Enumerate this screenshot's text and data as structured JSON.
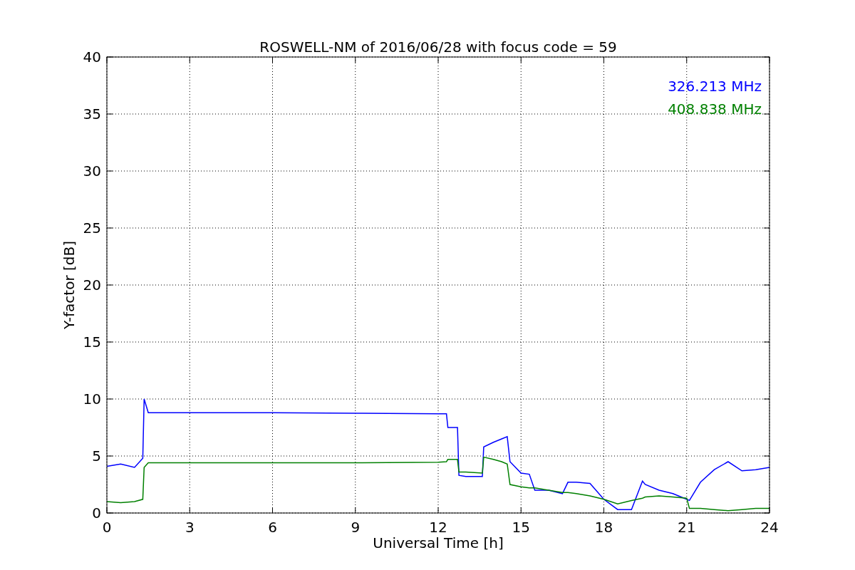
{
  "chart_data": {
    "type": "line",
    "title": "ROSWELL-NM of 2016/06/28 with focus code = 59",
    "xlabel": "Universal Time [h]",
    "ylabel": "Y-factor [dB]",
    "x": [
      0,
      0.5,
      1,
      1.3,
      1.35,
      1.5,
      3,
      6,
      9,
      12,
      12.3,
      12.35,
      12.7,
      12.75,
      13,
      13.6,
      13.65,
      14,
      14.3,
      14.5,
      14.6,
      15,
      15.3,
      15.5,
      16,
      16.5,
      16.7,
      17,
      17.5,
      18,
      18.5,
      19,
      19.4,
      19.5,
      20,
      20.5,
      21,
      21.1,
      21.5,
      22,
      22.5,
      23,
      23.5,
      24
    ],
    "series": [
      {
        "name": "326.213 MHz",
        "color": "#0000ff",
        "values": [
          4.1,
          4.3,
          4.0,
          4.8,
          10.0,
          8.8,
          8.8,
          8.8,
          8.75,
          8.7,
          8.7,
          7.5,
          7.5,
          3.3,
          3.2,
          3.2,
          5.8,
          6.2,
          6.5,
          6.7,
          4.5,
          3.5,
          3.4,
          2.0,
          2.0,
          1.7,
          2.7,
          2.7,
          2.6,
          1.2,
          0.3,
          0.3,
          2.8,
          2.5,
          2.0,
          1.7,
          1.2,
          1.1,
          2.7,
          3.8,
          4.5,
          3.7,
          3.8,
          4.0
        ]
      },
      {
        "name": "408.838 MHz",
        "color": "#008000",
        "values": [
          1.0,
          0.9,
          1.0,
          1.2,
          4.0,
          4.4,
          4.4,
          4.4,
          4.4,
          4.45,
          4.5,
          4.7,
          4.7,
          3.6,
          3.6,
          3.5,
          4.9,
          4.7,
          4.5,
          4.3,
          2.5,
          2.3,
          2.2,
          2.2,
          2.0,
          1.8,
          1.8,
          1.7,
          1.5,
          1.2,
          0.8,
          1.1,
          1.3,
          1.4,
          1.5,
          1.4,
          1.3,
          0.4,
          0.4,
          0.3,
          0.2,
          0.3,
          0.4,
          0.4
        ]
      }
    ],
    "grid": true,
    "xlim": [
      0,
      24
    ],
    "ylim": [
      0,
      40
    ],
    "xticks": [
      0,
      3,
      6,
      9,
      12,
      15,
      18,
      21,
      24
    ],
    "yticks": [
      0,
      5,
      10,
      15,
      20,
      25,
      30,
      35,
      40
    ]
  }
}
